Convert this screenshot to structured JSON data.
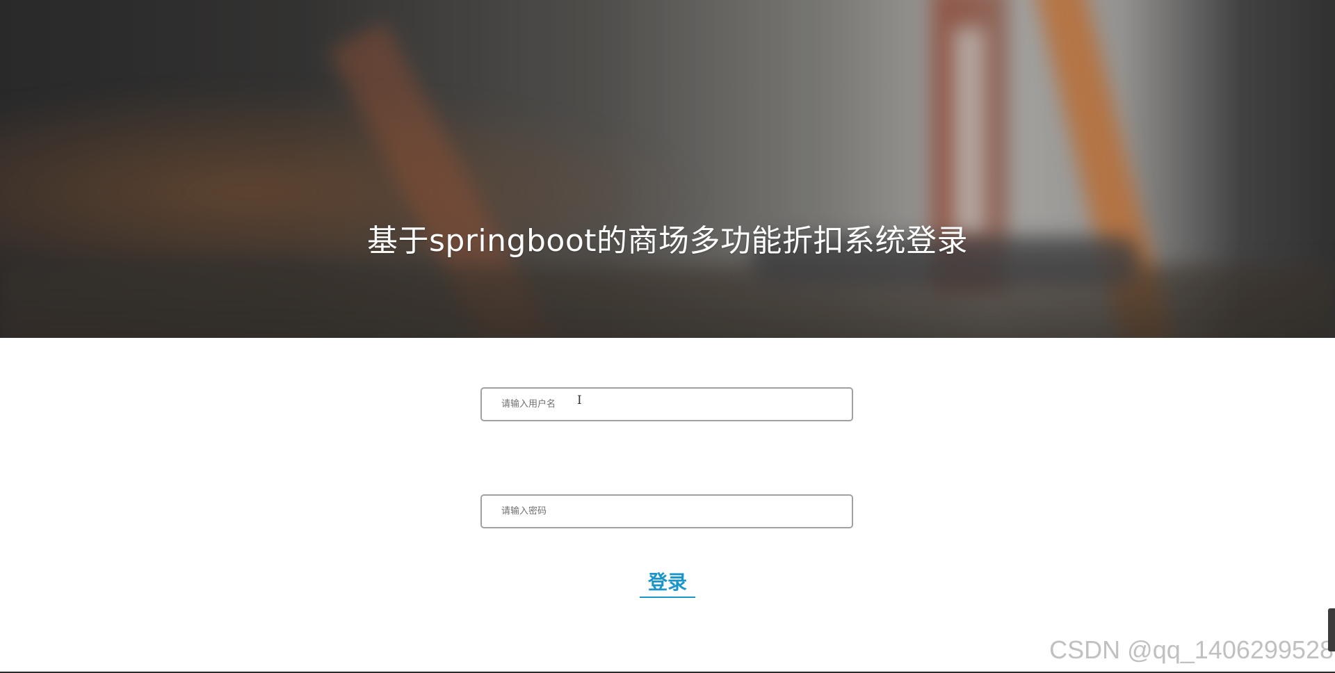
{
  "hero": {
    "title": "基于springboot的商场多功能折扣系统登录"
  },
  "form": {
    "username_placeholder": "请输入用户名",
    "username_value": "",
    "password_placeholder": "请输入密码",
    "password_value": "",
    "login_label": "登录"
  },
  "watermark": "CSDN @qq_1406299528",
  "colors": {
    "accent": "#1a95c9",
    "field_border": "#a0a0a0"
  }
}
